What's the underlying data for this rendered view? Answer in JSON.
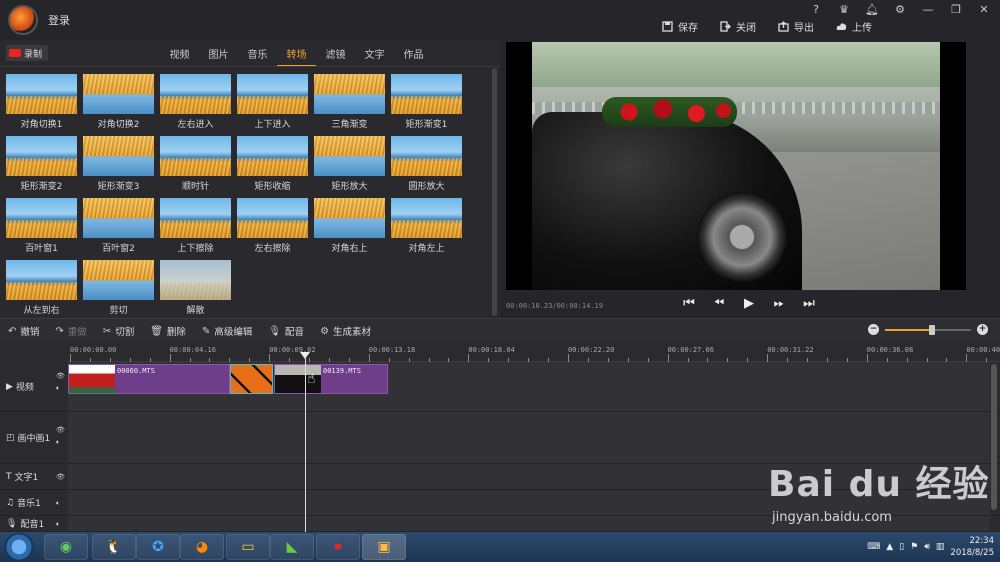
{
  "title_bar": {
    "login": "登录",
    "actions": {
      "save": "保存",
      "close": "关闭",
      "export": "导出",
      "upload": "上传"
    },
    "window_controls": [
      "?",
      "VIP",
      "bell",
      "gear",
      "minimize",
      "maximize",
      "close"
    ]
  },
  "left_panel": {
    "record": "录制",
    "tabs": [
      "视频",
      "图片",
      "音乐",
      "转场",
      "滤镜",
      "文字",
      "作品"
    ],
    "active_tab": "转场",
    "transitions": [
      "对角切换1",
      "对角切换2",
      "左右进入",
      "上下进入",
      "三角渐变",
      "矩形渐变1",
      "矩形渐变2",
      "矩形渐变3",
      "顺时针",
      "矩形收缩",
      "矩形放大",
      "圆形放大",
      "百叶窗1",
      "百叶窗2",
      "上下擦除",
      "左右擦除",
      "对角右上",
      "对角左上",
      "从左到右",
      "剪切",
      "解散"
    ]
  },
  "preview": {
    "timecode": "00:00:10.23/00:00:14.19",
    "controls": [
      "skip-to-start",
      "step-back",
      "play",
      "step-forward",
      "skip-to-end"
    ]
  },
  "toolbar": {
    "undo": "撤销",
    "redo": "重做",
    "cut": "切割",
    "delete": "删除",
    "advanced_edit": "高级编辑",
    "dub": "配音",
    "generate": "生成素材",
    "zoom_level": 0.55
  },
  "timeline": {
    "ruler": [
      "00:00:00.00",
      "00:00:04.16",
      "00:00:09.02",
      "00:00:13.18",
      "00:00:18.04",
      "00:00:22.20",
      "00:00:27.06",
      "00:00:31.22",
      "00:00:36.08",
      "00:00:40"
    ],
    "tracks": {
      "video": "视频",
      "pip": "画中画1",
      "text": "文字1",
      "music": "音乐1",
      "dub": "配音1"
    },
    "clips": [
      {
        "name": "00060.MTS"
      },
      {
        "name": "00139.MTS"
      }
    ]
  },
  "watermark": {
    "brand": "Bai  du 经验",
    "url": "jingyan.baidu.com"
  },
  "taskbar": {
    "time": "22:34",
    "date": "2018/8/25"
  },
  "colors": {
    "accent": "#f0a030",
    "clip": "#6f3e8a",
    "transition_border": "#4bc0c8"
  }
}
